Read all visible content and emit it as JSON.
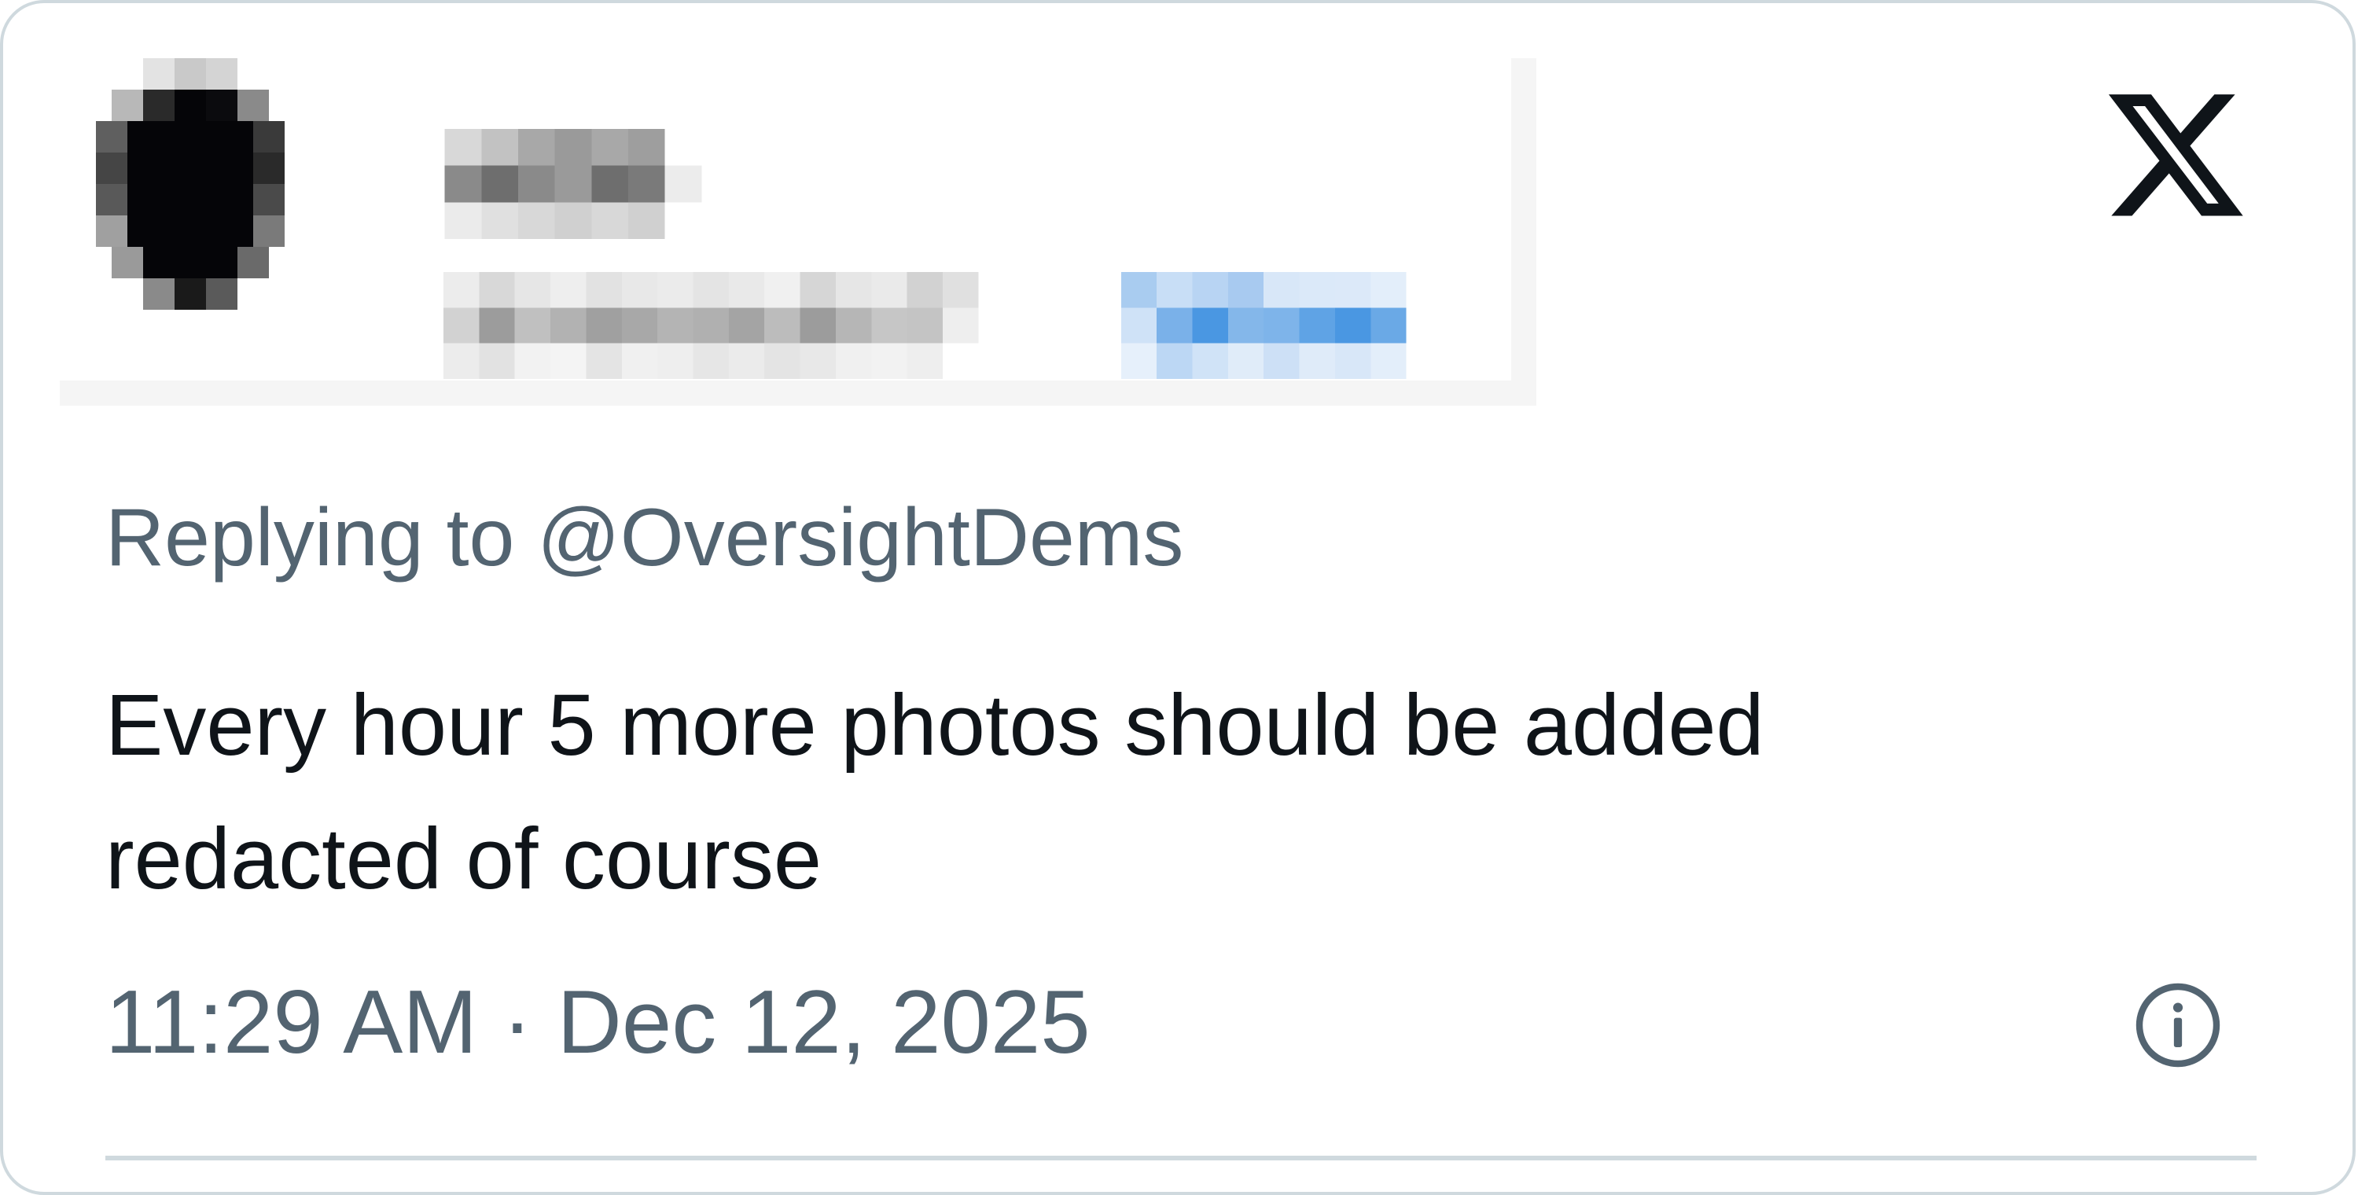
{
  "reply": {
    "prefix": "Replying to",
    "mention": "@OversightDems"
  },
  "tweet": {
    "line1": "Every hour 5 more photos should be added",
    "line2": "redacted of course"
  },
  "meta": {
    "time": "11:29 AM",
    "separator": "·",
    "date": "Dec 12, 2025"
  },
  "icons": {
    "brand": "x-logo-icon",
    "info": "info-icon"
  },
  "colors": {
    "text": "#0f1419",
    "secondary": "#536471",
    "border": "#cfd9de",
    "link_blurred": "#4a90e2"
  }
}
